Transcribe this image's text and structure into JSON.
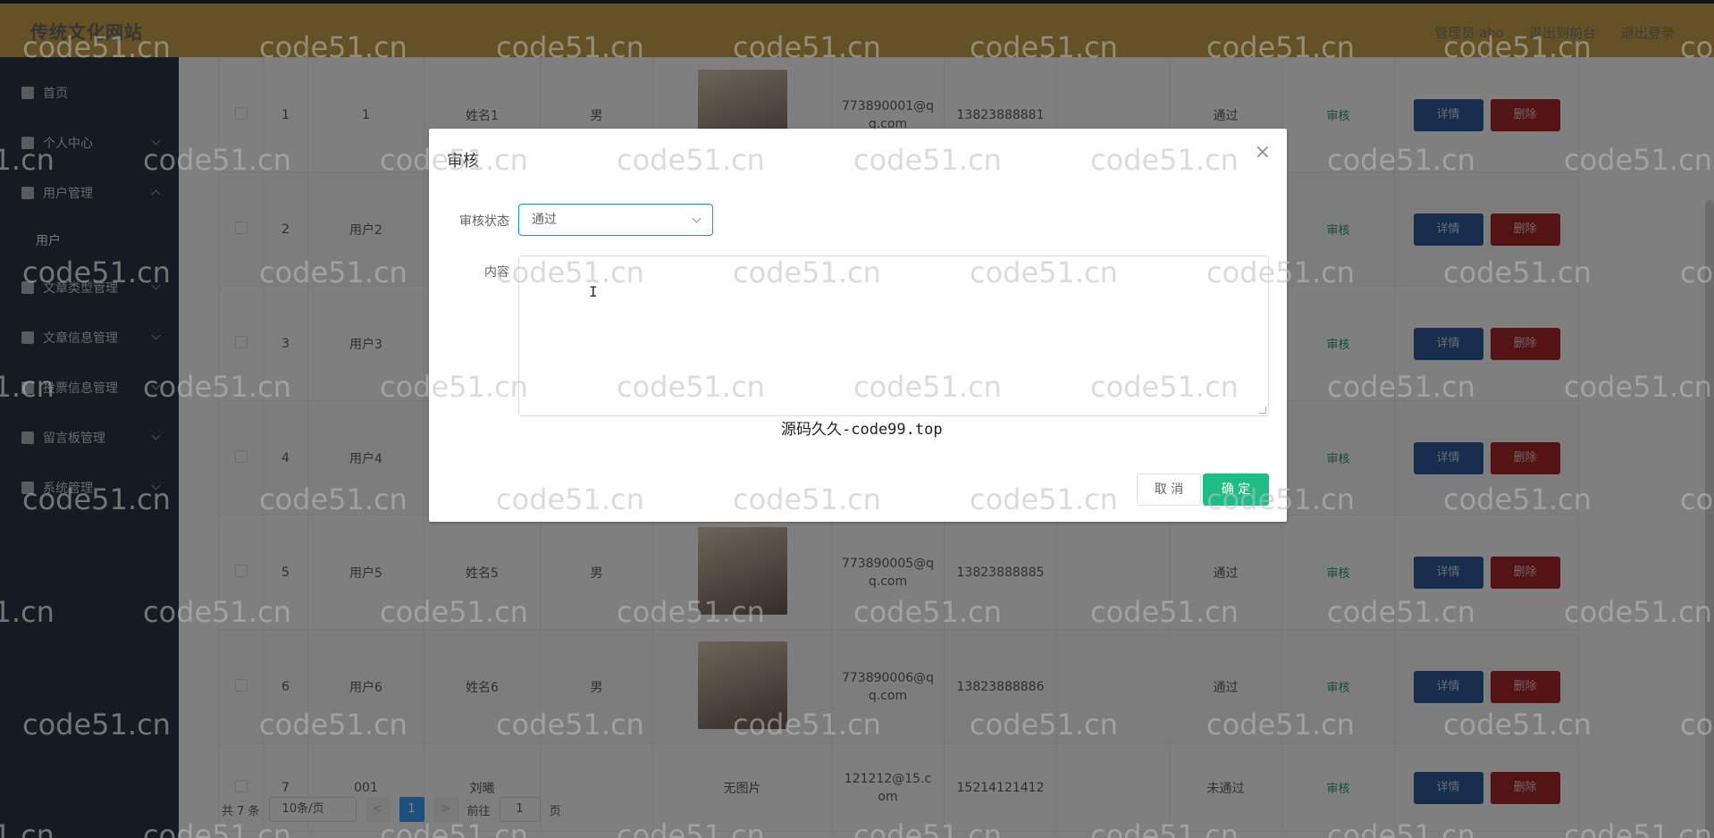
{
  "header": {
    "title": "传统文化网站",
    "admin_label": "管理员 abo",
    "back_label": "退出到前台",
    "logout_label": "退出登录"
  },
  "sidebar": {
    "items": [
      {
        "label": "首页",
        "icon": "home-icon"
      },
      {
        "label": "个人中心",
        "icon": "user-icon"
      },
      {
        "label": "用户管理",
        "icon": "users-icon",
        "expanded": true
      },
      {
        "label": "文章类型管理",
        "icon": "document-icon"
      },
      {
        "label": "文章信息管理",
        "icon": "article-icon"
      },
      {
        "label": "投票信息管理",
        "icon": "vote-icon"
      },
      {
        "label": "留言板管理",
        "icon": "message-icon"
      },
      {
        "label": "系统管理",
        "icon": "settings-icon"
      }
    ],
    "submenu_user": "用户"
  },
  "table": {
    "rows": [
      {
        "index": "1",
        "account": "1",
        "name": "姓名1",
        "gender": "男",
        "image": "avatar",
        "email": "773890001@qq.com",
        "phone": "13823888881",
        "status": "通过",
        "audit": "审核",
        "detail": "详情",
        "delete": "删除"
      },
      {
        "index": "2",
        "account": "用户2",
        "name": "",
        "gender": "",
        "image": "",
        "email": "",
        "phone": "",
        "status": "",
        "audit": "审核",
        "detail": "详情",
        "delete": "删除"
      },
      {
        "index": "3",
        "account": "用户3",
        "name": "",
        "gender": "",
        "image": "",
        "email": "",
        "phone": "",
        "status": "",
        "audit": "审核",
        "detail": "详情",
        "delete": "删除"
      },
      {
        "index": "4",
        "account": "用户4",
        "name": "",
        "gender": "",
        "image": "",
        "email": "",
        "phone": "",
        "status": "",
        "audit": "审核",
        "detail": "详情",
        "delete": "删除"
      },
      {
        "index": "5",
        "account": "用户5",
        "name": "姓名5",
        "gender": "男",
        "image": "avatar",
        "email": "773890005@qq.com",
        "phone": "13823888885",
        "status": "通过",
        "audit": "审核",
        "detail": "详情",
        "delete": "删除"
      },
      {
        "index": "6",
        "account": "用户6",
        "name": "姓名6",
        "gender": "男",
        "image": "avatar",
        "email": "773890006@qq.com",
        "phone": "13823888886",
        "status": "通过",
        "audit": "审核",
        "detail": "详情",
        "delete": "删除"
      },
      {
        "index": "7",
        "account": "001",
        "name": "刘曦",
        "gender": "",
        "image": "无图片",
        "email": "121212@15.com",
        "phone": "15214121412",
        "status": "未通过",
        "audit": "审核",
        "detail": "详情",
        "delete": "删除"
      }
    ]
  },
  "pager": {
    "total": "共 7 条",
    "page_size": "10条/页",
    "prev": "<",
    "current": "1",
    "next": ">",
    "goto_label": "前往",
    "goto_value": "1",
    "page_unit": "页"
  },
  "dialog": {
    "title": "审核",
    "close": "×",
    "status_label": "审核状态",
    "status_value": "通过",
    "content_label": "内容",
    "content_value": "",
    "source_note": "源码久久-code99.top",
    "cancel_label": "取 消",
    "ok_label": "确 定"
  },
  "watermark": "code51.cn",
  "colors": {
    "header_bg": "#c8a24a",
    "sidebar_bg": "#2d3645",
    "accent_green": "#1fbc85",
    "detail_btn": "#2d5d96",
    "delete_btn": "#a4262b"
  }
}
